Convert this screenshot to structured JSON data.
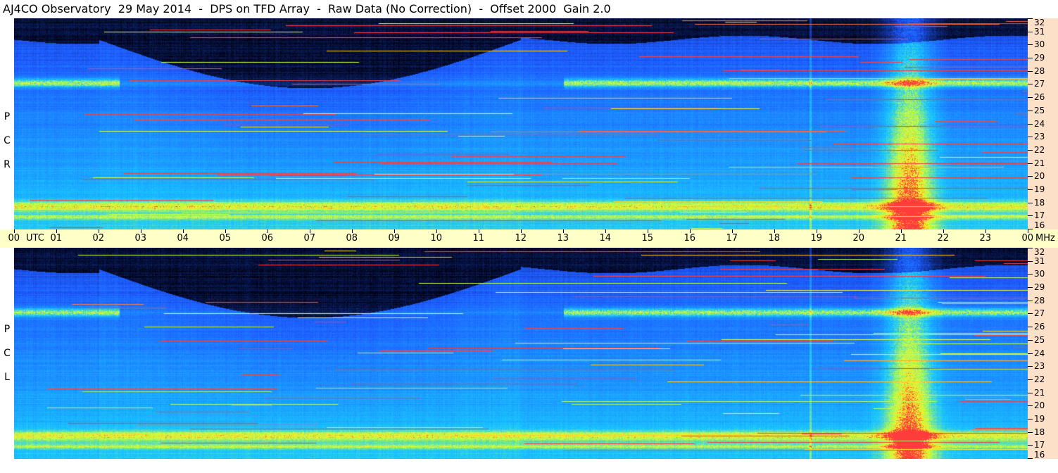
{
  "title": "AJ4CO Observatory  29 May 2014  -  DPS on TFD Array  -  Raw Data (No Correction)  -  Offset 2000  Gain 2.0",
  "panels": [
    {
      "id": "rcp",
      "label_letters": [
        "P",
        "C",
        "R"
      ]
    },
    {
      "id": "lcp",
      "label_letters": [
        "P",
        "C",
        "L"
      ]
    }
  ],
  "freq_axis": {
    "unit": "MHz",
    "labels": [
      "32",
      "31",
      "30",
      "29",
      "28",
      "27",
      "26",
      "25",
      "24",
      "23",
      "22",
      "21",
      "20",
      "19",
      "18",
      "17",
      "16"
    ]
  },
  "time_axis": {
    "unit": "UTC",
    "labels": [
      "00",
      "01",
      "02",
      "03",
      "04",
      "05",
      "06",
      "07",
      "08",
      "09",
      "10",
      "11",
      "12",
      "13",
      "14",
      "15",
      "16",
      "17",
      "18",
      "19",
      "20",
      "21",
      "22",
      "23",
      "00"
    ]
  },
  "colors": {
    "background_dark": "#000010",
    "cool": "#1e5aff",
    "mid": "#19c8ff",
    "warm": "#c8ff3c",
    "hot": "#ff3c3c",
    "time_axis_bg": "#ffffc8",
    "freq_axis_bg": "#fde0c8"
  }
}
